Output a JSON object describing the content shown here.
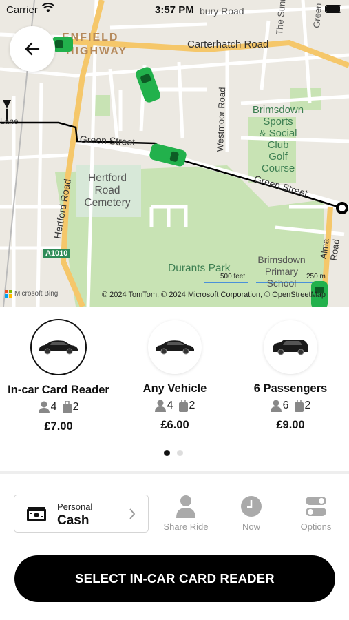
{
  "status_bar": {
    "carrier": "Carrier",
    "time": "3:57 PM"
  },
  "map": {
    "labels": {
      "enfield": "ENFIELD",
      "highway": "HIGHWAY",
      "carterhatch": "Carterhatch Road",
      "brimsdown_club_1": "Brimsdown",
      "brimsdown_club_2": "Sports",
      "brimsdown_club_3": "& Social",
      "brimsdown_club_4": "Club",
      "brimsdown_club_5": "Golf",
      "brimsdown_club_6": "Course",
      "green_street_1": "Green Street",
      "green_street_2": "Green Street",
      "westmoor": "Westmoor Road",
      "hertford_cemetery_1": "Hertford",
      "hertford_cemetery_2": "Road",
      "hertford_cemetery_3": "Cemetery",
      "hertford_road": "Hertford Road",
      "a1010": "A1010",
      "durants": "Durants Park",
      "brimsdown_school_1": "Brimsdown",
      "brimsdown_school_2": "Primary",
      "brimsdown_school_3": "School",
      "alma": "Alma Road",
      "the_sunny": "The Sunny",
      "greenfield": "Green",
      "lane": "Lane",
      "bury_road": "bury Road"
    },
    "scale_feet": "500 feet",
    "scale_m": "250 m",
    "attribution": "© 2024 TomTom, © 2024 Microsoft Corporation, ©",
    "attribution_link": "OpenStreetMap",
    "bing": "Microsoft Bing"
  },
  "vehicles": [
    {
      "name": "In-car Card Reader",
      "passengers": "4",
      "bags": "2",
      "price": "£7.00",
      "selected": true
    },
    {
      "name": "Any Vehicle",
      "passengers": "4",
      "bags": "2",
      "price": "£6.00",
      "selected": false
    },
    {
      "name": "6 Passengers",
      "passengers": "6",
      "bags": "2",
      "price": "£9.00",
      "selected": false
    }
  ],
  "payment": {
    "label": "Personal",
    "value": "Cash"
  },
  "options": [
    {
      "label": "Share Ride",
      "icon": "person-icon"
    },
    {
      "label": "Now",
      "icon": "clock-icon"
    },
    {
      "label": "Options",
      "icon": "toggles-icon"
    }
  ],
  "cta": {
    "label": "SELECT IN-CAR CARD READER"
  },
  "colors": {
    "accent": "#000000",
    "car_marker": "#22b14c",
    "park": "#c8e3b4",
    "road_major": "#f5c76a"
  }
}
